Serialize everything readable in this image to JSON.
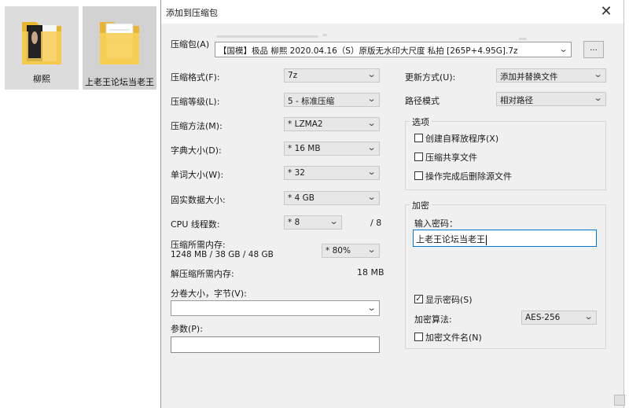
{
  "desktop": {
    "items": [
      {
        "label": "柳熙"
      },
      {
        "label": "上老王论坛当老王"
      }
    ]
  },
  "dialog": {
    "title": "添加到压缩包",
    "close_glyph": "✕",
    "archive_label": "压缩包(A)",
    "archive_value": "【国模】极品 柳熙 2020.04.16（S）原版无水印大尺度 私拍 [265P+4.95G].7z",
    "browse_label": "...",
    "format_label": "压缩格式(F):",
    "format_value": "7z",
    "level_label": "压缩等级(L):",
    "level_value": "5 - 标准压缩",
    "method_label": "压缩方法(M):",
    "method_value": "* LZMA2",
    "dict_label": "字典大小(D):",
    "dict_value": "* 16 MB",
    "word_label": "单词大小(W):",
    "word_value": "* 32",
    "solid_label": "固实数据大小:",
    "solid_value": "* 4 GB",
    "cpu_label": "CPU 线程数:",
    "cpu_value": "* 8",
    "cpu_max": "/ 8",
    "mem_compress_label": "压缩所需内存:",
    "mem_compress_value": "1248 MB / 38 GB / 48 GB",
    "mem_percent": "* 80%",
    "mem_decompress_label": "解压缩所需内存:",
    "mem_decompress_value": "18 MB",
    "volume_label": "分卷大小，字节(V):",
    "volume_value": "",
    "params_label": "参数(P):",
    "params_value": "",
    "update_label": "更新方式(U):",
    "update_value": "添加并替换文件",
    "path_label": "路径模式",
    "path_value": "相对路径",
    "options_title": "选项",
    "options": [
      {
        "label": "创建自释放程序(X)",
        "checked": false
      },
      {
        "label": "压缩共享文件",
        "checked": false
      },
      {
        "label": "操作完成后删除源文件",
        "checked": false
      }
    ],
    "encrypt_title": "加密",
    "password_label": "输入密码：",
    "password_value": "上老王论坛当老王",
    "show_password_label": "显示密码(S)",
    "show_password_checked": true,
    "encrypt_method_label": "加密算法:",
    "encrypt_method_value": "AES-256",
    "encrypt_names_label": "加密文件名(N)",
    "encrypt_names_checked": false
  },
  "icons": {
    "folder": "folder-icon",
    "close": "close-icon",
    "dropdown": "chevron-down-icon",
    "check": "check-icon"
  },
  "colors": {
    "dialog_bg": "#f0f0f0",
    "folder": "#f5c842",
    "selection": "#dcdcdc",
    "focus_border": "#0078d7"
  }
}
